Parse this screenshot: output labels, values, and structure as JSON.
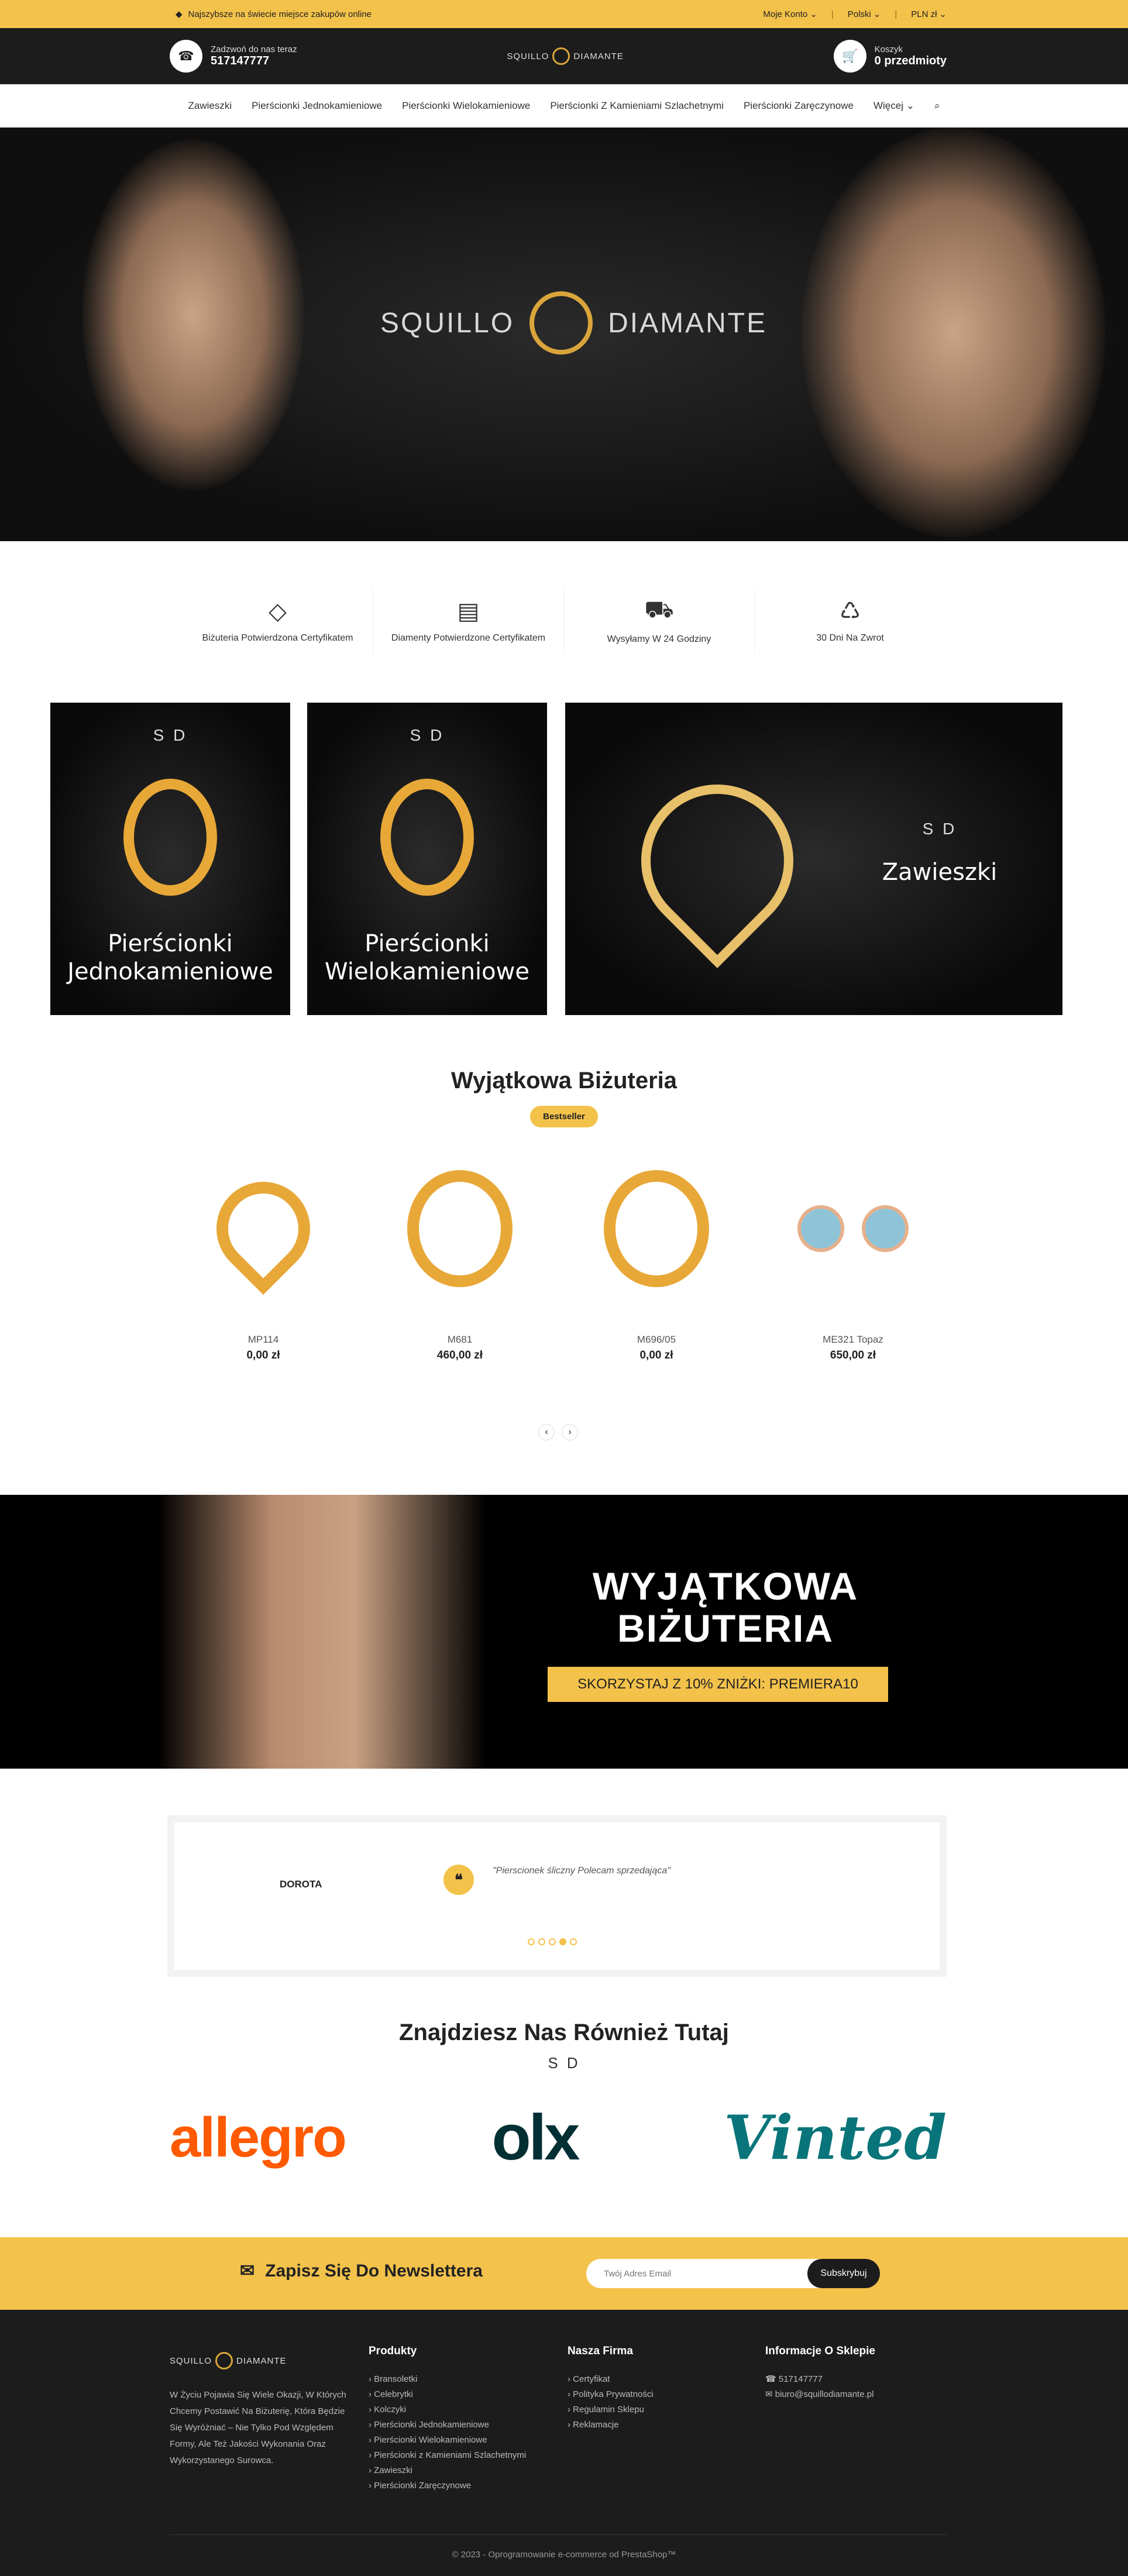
{
  "topbar": {
    "promo": "Najszybsze na świecie miejsce zakupów online",
    "account": "Moje Konto",
    "language": "Polski",
    "currency": "PLN zł"
  },
  "header": {
    "call_small": "Zadzwoń do nas teraz",
    "phone": "517147777",
    "cart_label": "Koszyk",
    "cart_count": "0 przedmioty",
    "logo_left": "SQUILLO",
    "logo_right": "DIAMANTE"
  },
  "nav": [
    "Zawieszki",
    "Pierścionki Jednokamieniowe",
    "Pierścionki Wielokamieniowe",
    "Pierścionki Z Kamieniami Szlachetnymi",
    "Pierścionki Zaręczynowe",
    "Więcej"
  ],
  "hero": {
    "left": "SQUILLO",
    "right": "DIAMANTE"
  },
  "features": [
    "Biżuteria Potwierdzona Certyfikatem",
    "Diamenty Potwierdzone Certyfikatem",
    "Wysyłamy W 24 Godziny",
    "30 Dni Na Zwrot"
  ],
  "banners": [
    {
      "sod": "S D",
      "title": "Pierścionki Jednokamieniowe"
    },
    {
      "sod": "S D",
      "title": "Pierścionki Wielokamieniowe"
    },
    {
      "sod": "S D",
      "title": "Zawieszki"
    }
  ],
  "bestseller": {
    "title": "Wyjątkowa Biżuteria",
    "pill": "Bestseller"
  },
  "products": [
    {
      "name": "MP114",
      "price": "0,00 zł"
    },
    {
      "name": "M681",
      "price": "460,00 zł"
    },
    {
      "name": "M696/05",
      "price": "0,00 zł"
    },
    {
      "name": "ME321 Topaz",
      "price": "650,00 zł"
    }
  ],
  "promo": {
    "heading1": "WYJĄTKOWA",
    "heading2": "BIŻUTERIA",
    "button": "SKORZYSTAJ Z 10% ZNIŻKI: PREMIERA10"
  },
  "testimonial": {
    "name": "DOROTA",
    "text": "\"Pierscionek śliczny Polecam sprzedająca\""
  },
  "partners": {
    "title": "Znajdziesz Nas Również Tutaj",
    "sod": "S D",
    "items": [
      "allegro",
      "olx",
      "Vinted"
    ]
  },
  "newsletter": {
    "label": "Zapisz Się Do Newslettera",
    "placeholder": "Twój Adres Email",
    "button": "Subskrybuj"
  },
  "footer": {
    "about": "W Życiu Pojawia Się Wiele Okazji, W Których Chcemy Postawić Na Biżuterię, Która Będzie Się Wyróżniać – Nie Tylko Pod Względem Formy, Ale Też Jakości Wykonania Oraz Wykorzystanego Surowca.",
    "col1_title": "Produkty",
    "col1": [
      "Bransoletki",
      "Celebrytki",
      "Kolczyki",
      "Pierścionki Jednokamieniowe",
      "Pierścionki Wielokamieniowe",
      "Pierścionki z Kamieniami Szlachetnymi",
      "Zawieszki",
      "Pierścionki Zaręczynowe"
    ],
    "col2_title": "Nasza Firma",
    "col2": [
      "Certyfikat",
      "Polityka Prywatności",
      "Regulamin Sklepu",
      "Reklamacje"
    ],
    "col3_title": "Informacje O Sklepie",
    "phone": "517147777",
    "email": "biuro@squillodiamante.pl",
    "copy": "© 2023 - Oprogramowanie e-commerce od PrestaShop™"
  }
}
